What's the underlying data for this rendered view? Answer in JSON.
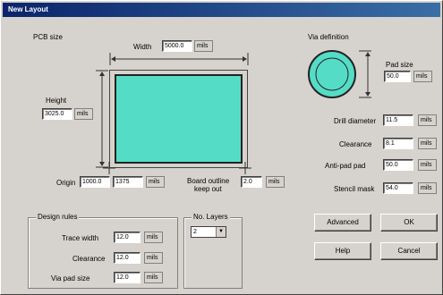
{
  "window": {
    "title": "New Layout"
  },
  "pcb": {
    "section_label": "PCB size",
    "width_label": "Width",
    "width_value": "5000.0",
    "width_unit": "mils",
    "height_label": "Height",
    "height_value": "3025.0",
    "height_unit": "mils",
    "origin_label": "Origin",
    "origin_x": "1000.0",
    "origin_y": "1375",
    "origin_unit": "mils",
    "board_outline_label": "Board outline",
    "board_outline_sublabel": "keep out",
    "board_outline_value": "2.0",
    "board_outline_unit": "mils"
  },
  "via": {
    "section_label": "Via definition",
    "pad_size_label": "Pad size",
    "pad_size_value": "50.0",
    "pad_size_unit": "mils",
    "drill_label": "Drill diameter",
    "drill_value": "11.5",
    "drill_unit": "mils",
    "clearance_label": "Clearance",
    "clearance_value": "8.1",
    "clearance_unit": "mils",
    "antipad_label": "Anti-pad pad",
    "antipad_value": "50.0",
    "antipad_unit": "mils",
    "stencil_label": "Stencil mask",
    "stencil_value": "54.0",
    "stencil_unit": "mils",
    "colors": {
      "pad": "#55dcc7"
    }
  },
  "design_rules": {
    "section_label": "Design rules",
    "trace_width_label": "Trace width",
    "trace_width_value": "12.0",
    "trace_width_unit": "mils",
    "clearance_label": "Clearance",
    "clearance_value": "12.0",
    "clearance_unit": "mils",
    "via_pad_label": "Via pad size",
    "via_pad_value": "12.0",
    "via_pad_unit": "mils"
  },
  "layers": {
    "label": "No. Layers",
    "value": "2"
  },
  "buttons": {
    "advanced": "Advanced",
    "ok": "OK",
    "help": "Help",
    "cancel": "Cancel"
  }
}
